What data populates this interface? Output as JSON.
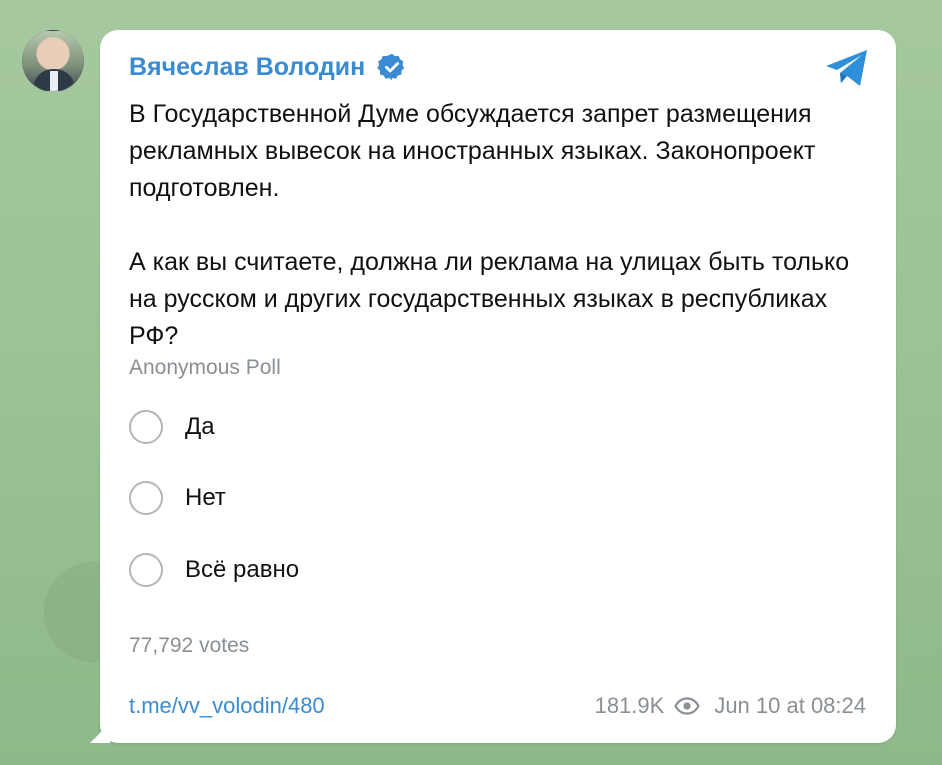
{
  "author": {
    "name": "Вячеслав Володин"
  },
  "post": {
    "paragraph1": "В Государственной Думе обсуждается запрет размещения рекламных вывесок на иностранных языках. Законопроект подготовлен.",
    "paragraph2": "А как вы считаете, должна ли реклама на улицах быть только на русском и других государственных языках в республиках РФ?"
  },
  "poll": {
    "type": "Anonymous Poll",
    "options": [
      {
        "label": "Да"
      },
      {
        "label": "Нет"
      },
      {
        "label": "Всё равно"
      }
    ],
    "votes": "77,792 votes"
  },
  "footer": {
    "link": "t.me/vv_volodin/480",
    "views": "181.9K",
    "date": "Jun 10 at 08:24"
  },
  "colors": {
    "accent": "#3a8bd1",
    "background": "#9fc39a",
    "muted": "#8a8f94"
  },
  "icons": {
    "verified": "verified-badge-icon",
    "telegram": "telegram-icon",
    "views": "eye-icon"
  }
}
